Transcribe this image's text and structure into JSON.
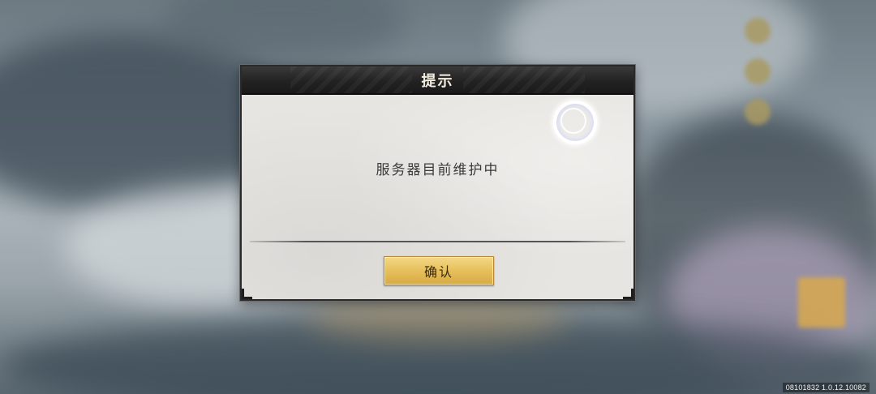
{
  "dialog": {
    "title": "提示",
    "message": "服务器目前维护中",
    "confirm_label": "确认",
    "icon": "loading-ring-icon"
  },
  "footer": {
    "version": "08101832  1.0.12.10082"
  },
  "colors": {
    "dialog_bg": "#e7e5e1",
    "title_bar": "#222222",
    "confirm_button": "#e9c462"
  }
}
